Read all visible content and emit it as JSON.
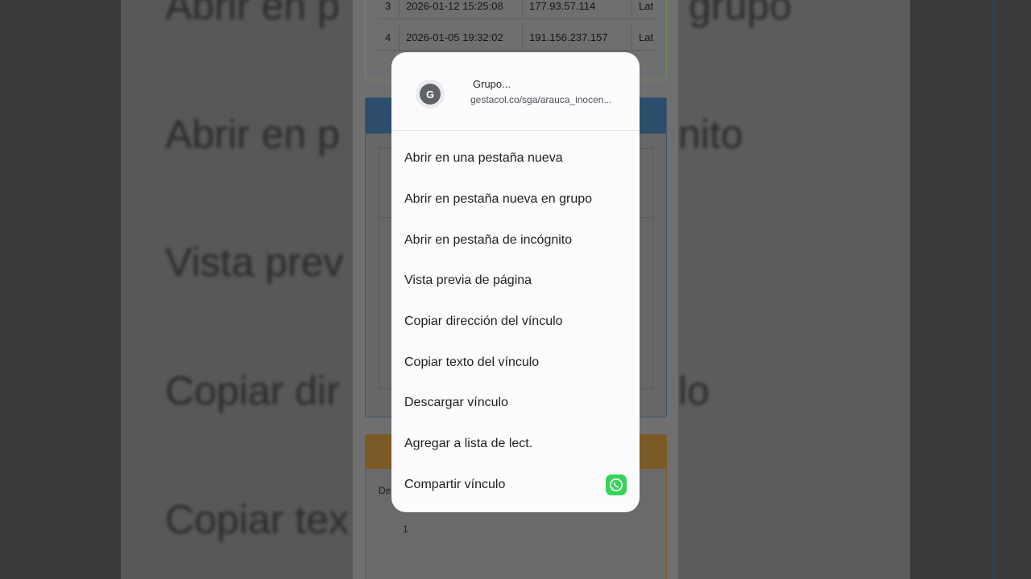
{
  "background": {
    "left_words": [
      "Abrir en p",
      "Abrir en p",
      "Vista prev",
      "Copiar dir",
      "Copiar tex"
    ],
    "right_words": [
      "grupo",
      "nito",
      "lo"
    ]
  },
  "page": {
    "rows": [
      {
        "num": "3",
        "date": "2026-01-12 15:25:08",
        "ip": "177.93.57.114",
        "loc": "Lat"
      },
      {
        "num": "4",
        "date": "2026-01-05 19:32:02",
        "ip": "191.156.237.157",
        "loc": "Lat"
      }
    ],
    "orange_label": "De",
    "orange_value": "1"
  },
  "menu": {
    "favicon_letter": "G",
    "link_title": "Grupo...",
    "link_url": "gestacol.co/sga/arauca_inocen...",
    "items": [
      {
        "label": "Abrir en una pestaña nueva"
      },
      {
        "label": "Abrir en pestaña nueva en grupo"
      },
      {
        "label": "Abrir en pestaña de incógnito"
      },
      {
        "label": "Vista previa de página"
      },
      {
        "label": "Copiar dirección del vínculo"
      },
      {
        "label": "Copiar texto del vínculo"
      },
      {
        "label": "Descargar vínculo"
      },
      {
        "label": "Agregar a lista de lect."
      },
      {
        "label": "Compartir vínculo"
      }
    ],
    "share_icon": "whatsapp-icon"
  },
  "colors": {
    "menu_bg": "#fcfbfe",
    "whatsapp": "#37d25a",
    "blue_header": "#2c4d6b",
    "orange_header": "#7c5a26"
  }
}
